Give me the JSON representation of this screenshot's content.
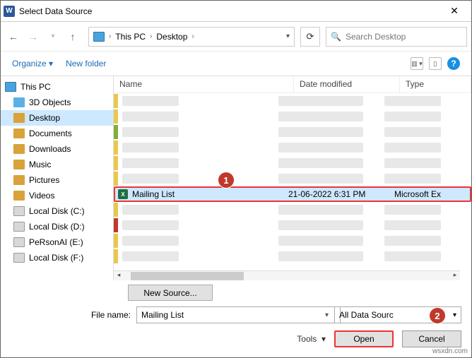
{
  "window": {
    "title": "Select Data Source"
  },
  "breadcrumb": {
    "root": "This PC",
    "current": "Desktop"
  },
  "search": {
    "placeholder": "Search Desktop"
  },
  "toolbar": {
    "organize": "Organize",
    "newfolder": "New folder"
  },
  "sidebar": {
    "items": [
      {
        "label": "This PC",
        "cls": "pc",
        "lvl": 0,
        "sel": false
      },
      {
        "label": "3D Objects",
        "cls": "obj",
        "lvl": 1,
        "sel": false
      },
      {
        "label": "Desktop",
        "cls": "",
        "lvl": 1,
        "sel": true
      },
      {
        "label": "Documents",
        "cls": "",
        "lvl": 1,
        "sel": false
      },
      {
        "label": "Downloads",
        "cls": "",
        "lvl": 1,
        "sel": false
      },
      {
        "label": "Music",
        "cls": "",
        "lvl": 1,
        "sel": false
      },
      {
        "label": "Pictures",
        "cls": "",
        "lvl": 1,
        "sel": false
      },
      {
        "label": "Videos",
        "cls": "",
        "lvl": 1,
        "sel": false
      },
      {
        "label": "Local Disk (C:)",
        "cls": "disk",
        "lvl": 1,
        "sel": false
      },
      {
        "label": "Local Disk (D:)",
        "cls": "disk",
        "lvl": 1,
        "sel": false
      },
      {
        "label": "PeRsonAI (E:)",
        "cls": "disk",
        "lvl": 1,
        "sel": false
      },
      {
        "label": "Local Disk (F:)",
        "cls": "disk",
        "lvl": 1,
        "sel": false
      }
    ]
  },
  "columns": {
    "name": "Name",
    "date": "Date modified",
    "type": "Type"
  },
  "selected_file": {
    "name": "Mailing List",
    "date": "21-06-2022 6:31 PM",
    "type": "Microsoft Ex"
  },
  "newsource": {
    "label": "New Source..."
  },
  "footer": {
    "filename_label": "File name:",
    "filename_value": "Mailing List",
    "filter": "All Data Sourc",
    "tools": "Tools",
    "open": "Open",
    "cancel": "Cancel"
  },
  "annotations": {
    "m1": "1",
    "m2": "2"
  },
  "watermark": "wsxdn.com",
  "stripe_colors": [
    "#e8c84d",
    "#e8c84d",
    "#7fae3d",
    "#e8c84d",
    "#e8c84d",
    "#e8c84d"
  ],
  "stripe_colors_after": [
    "#e8c84d",
    "#c0392b",
    "#e8c84d",
    "#e8c84d"
  ]
}
